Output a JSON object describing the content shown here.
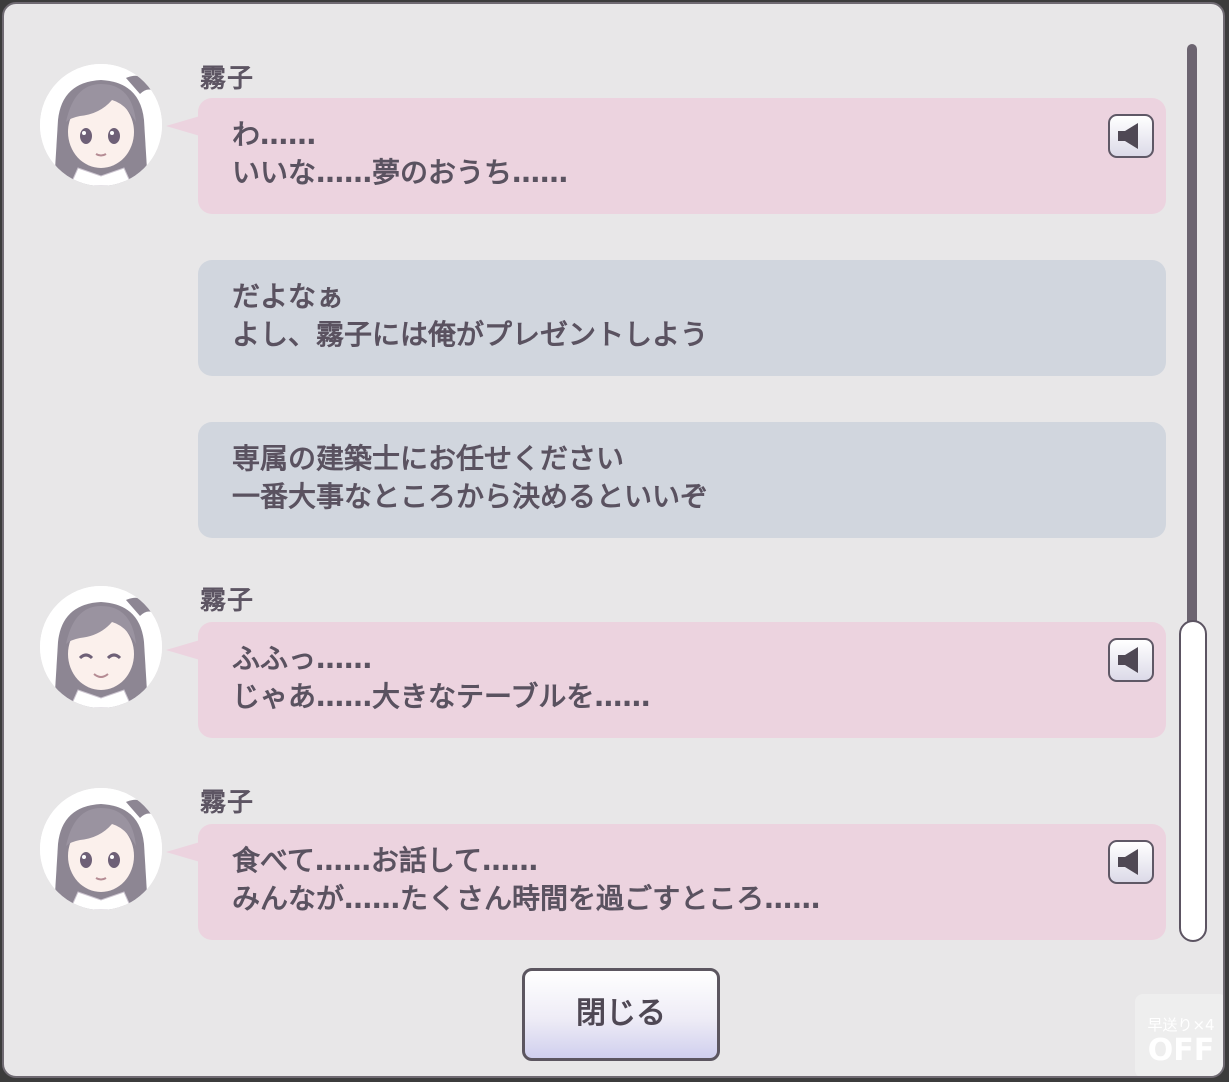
{
  "log": {
    "messages": [
      {
        "speaker": "霧子",
        "lines": [
          "わ……",
          "いいな……夢のおうち……"
        ],
        "style": "character",
        "has_voice": true
      },
      {
        "speaker": "",
        "lines": [
          "だよなぁ",
          "よし、霧子には俺がプレゼントしよう"
        ],
        "style": "player",
        "has_voice": false
      },
      {
        "speaker": "",
        "lines": [
          "専属の建築士にお任せください",
          "一番大事なところから決めるといいぞ"
        ],
        "style": "player",
        "has_voice": false
      },
      {
        "speaker": "霧子",
        "lines": [
          "ふふっ……",
          "じゃあ……大きなテーブルを……"
        ],
        "style": "character",
        "has_voice": true
      },
      {
        "speaker": "霧子",
        "lines": [
          "食べて……お話して……",
          "みんなが……たくさん時間を過ごすところ……"
        ],
        "style": "character",
        "has_voice": true
      }
    ]
  },
  "close_button": {
    "label": "閉じる"
  },
  "speed_indicator": {
    "label_top": "早送り×4",
    "label_bottom": "OFF"
  },
  "icons": {
    "voice": "speaker-icon",
    "avatar": "character-avatar-icon"
  },
  "colors": {
    "panel_bg": "#e8e7e8",
    "character_bubble": "#ecd3df",
    "player_bubble": "#d1d6de",
    "text": "#5a5260",
    "scrollbar": "#6c6470"
  }
}
